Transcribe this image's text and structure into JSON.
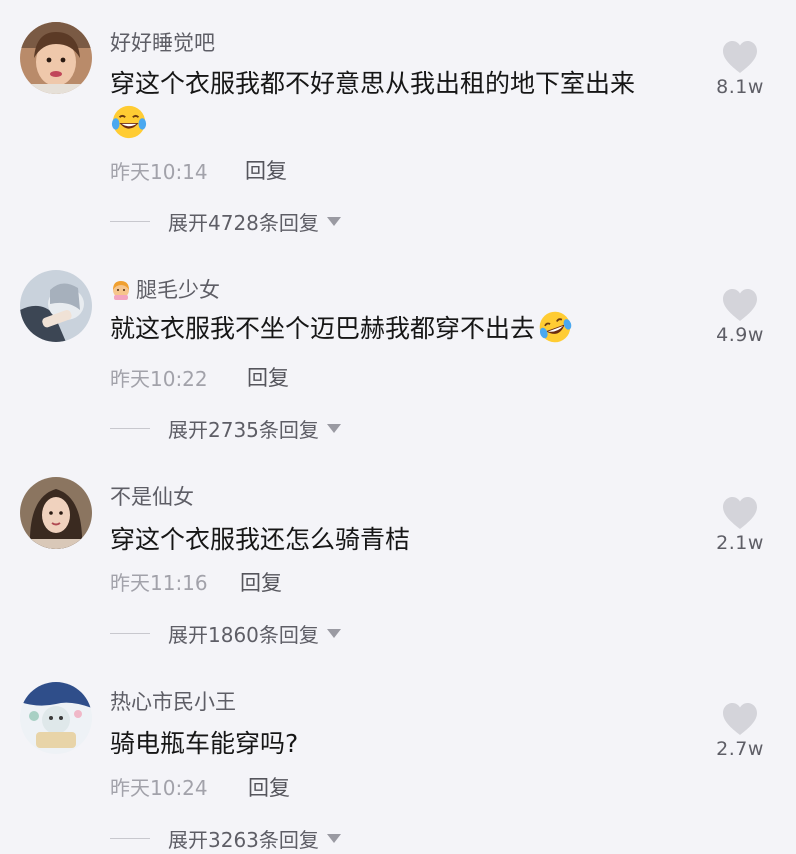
{
  "comments": [
    {
      "username": "好好睡觉吧",
      "text": "穿这个衣服我都不好意思从我出租的地下室出来",
      "emoji": "laughing-tears-emoji",
      "time": "昨天10:14",
      "reply_label": "回复",
      "expand_label": "展开4728条回复",
      "likes": "8.1w"
    },
    {
      "username": "腿毛少女",
      "username_prefix_icon": "girl-emoji",
      "text": "就这衣服我不坐个迈巴赫我都穿不出去",
      "emoji": "rolling-laughing-emoji",
      "time": "昨天10:22",
      "reply_label": "回复",
      "expand_label": "展开2735条回复",
      "likes": "4.9w"
    },
    {
      "username": "不是仙女",
      "text": "穿这个衣服我还怎么骑青桔",
      "time": "昨天11:16",
      "reply_label": "回复",
      "expand_label": "展开1860条回复",
      "likes": "2.1w"
    },
    {
      "username": "热心市民小王",
      "text": "骑电瓶车能穿吗?",
      "time": "昨天10:24",
      "reply_label": "回复",
      "expand_label": "展开3263条回复",
      "likes": "2.7w"
    }
  ],
  "colors": {
    "background": "#f4f4f8",
    "heart": "#d4d4da",
    "username": "#5e5e66",
    "meta": "#a2a2aa"
  }
}
